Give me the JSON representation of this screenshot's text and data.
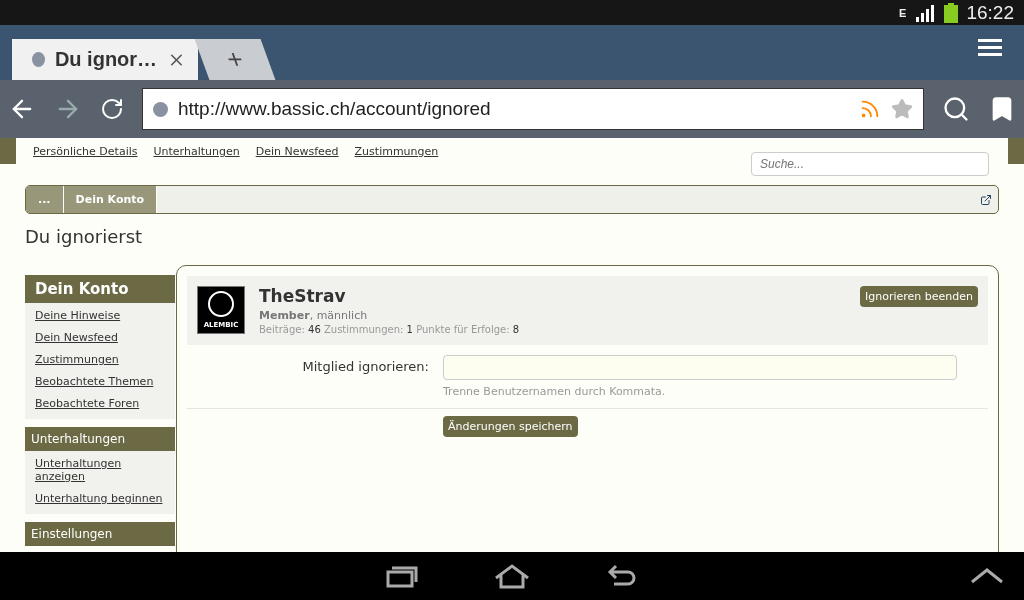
{
  "status_bar": {
    "network": "E",
    "time": "16:22"
  },
  "tabs": [
    {
      "title": "Du ignor…",
      "selected": true
    }
  ],
  "new_tab": "+",
  "address_bar": {
    "url": "http://www.bassic.ch/account/ignored"
  },
  "top_nav": [
    "Persönliche Details",
    "Unterhaltungen",
    "Dein Newsfeed",
    "Zustimmungen"
  ],
  "search": {
    "placeholder": "Suche..."
  },
  "breadcrumb": [
    "...",
    "Dein Konto"
  ],
  "heading": "Du ignorierst",
  "sidebar": [
    {
      "title": "Dein Konto",
      "kind": "main",
      "items": [
        "Deine Hinweise",
        "Dein Newsfeed",
        "Zustimmungen",
        "Beobachtete Themen",
        "Beobachtete Foren"
      ]
    },
    {
      "title": "Unterhaltungen",
      "kind": "sub",
      "items": [
        "Unterhaltungen anzeigen",
        "Unterhaltung beginnen"
      ]
    },
    {
      "title": "Einstellungen",
      "kind": "sub"
    }
  ],
  "ignored_user": {
    "name": "TheStrav",
    "info": "**Member**, männlich",
    "avatar_text": "ALEMBIC",
    "stats": [
      {
        "label": "Beiträge:",
        "value": "46"
      },
      {
        "label": "Zustimmungen:",
        "value": "1"
      },
      {
        "label": "Punkte für Erfolge:",
        "value": "8"
      }
    ],
    "button": "Ignorieren beenden"
  },
  "form": {
    "label": "Mitglied ignorieren:",
    "hint": "Trenne Benutzernamen durch Kommata.",
    "submit": "Änderungen speichern"
  }
}
